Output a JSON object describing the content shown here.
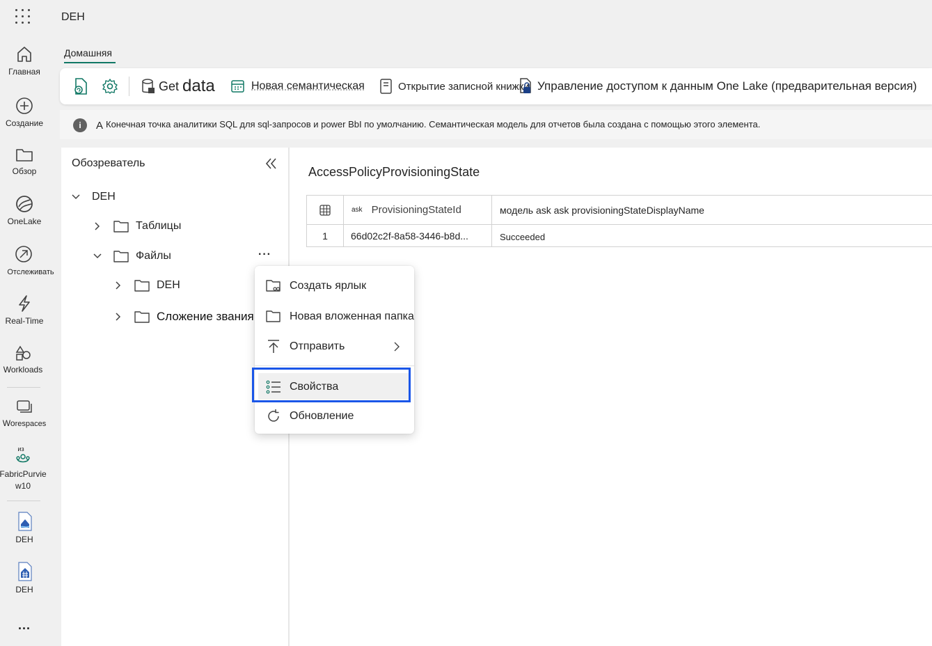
{
  "app": {
    "title": "DEH"
  },
  "rail": {
    "items": [
      {
        "label": "Главная",
        "icon": "home-icon"
      },
      {
        "label": "Создание",
        "icon": "plus-circle-icon"
      },
      {
        "label": "Обзор",
        "icon": "folder-icon"
      },
      {
        "label": "OneLake",
        "icon": "onelake-icon"
      },
      {
        "label": "Отслеживать",
        "icon": "monitor-icon"
      },
      {
        "label": "Real-Time",
        "icon": "lightning-icon"
      },
      {
        "label": "Workloads",
        "icon": "shapes-icon"
      },
      {
        "label_a": "Wo",
        "label_b": "respaces",
        "icon": "workspaces-icon"
      },
      {
        "label_top": "из",
        "label_1": "FabricPurvie",
        "label_2": "w10",
        "icon": "workspace-people-icon"
      },
      {
        "label": "DEH",
        "icon": "lakehouse-icon"
      },
      {
        "label": "DEH",
        "icon": "warehouse-icon"
      }
    ],
    "more": "..."
  },
  "ribbon": {
    "tab": "Домашняя",
    "get_data_a": "Get",
    "get_data_b": "data",
    "new_semantic": "Новая семантическая",
    "open_notebook": "Открытие записной книжки",
    "onelake_access": "Управление доступом к данным One Lake (предварительная версия)"
  },
  "info": {
    "prefix": "A",
    "text": "Конечная точка аналитики SQL для sql-запросов и power BbI по умолчанию. Семантическая модель для отчетов была создана с помощью этого элемента."
  },
  "explorer": {
    "title": "Обозреватель",
    "root": "DEH",
    "tables": "Таблицы",
    "files": "Файлы",
    "more": "···",
    "sub1": "DEH",
    "sub2": "Сложение звания"
  },
  "table": {
    "title": "AccessPolicyProvisioningState",
    "col1_type": "ask",
    "col1": "ProvisioningStateId",
    "col2": "модель ask ask provisioningStateDisplayName",
    "row_num": "1",
    "row_id": "66d02c2f-8a58-3446-b8d...",
    "row_state": "Succeeded"
  },
  "context_menu": {
    "create_shortcut": "Создать ярлык",
    "new_subfolder": "Новая вложенная папка",
    "upload": "Отправить",
    "properties": "Свойства",
    "refresh": "Обновление"
  },
  "colors": {
    "accent": "#117865",
    "highlight": "#1a56e8"
  }
}
